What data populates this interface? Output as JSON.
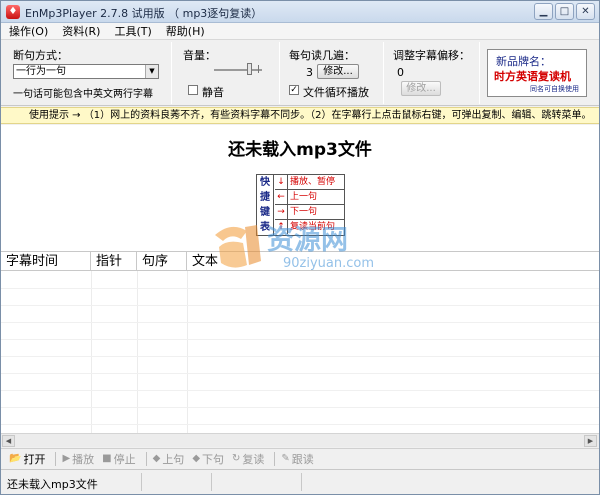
{
  "window": {
    "title": "EnMp3Player 2.7.8 试用版 （ mp3逐句复读）",
    "controls": {
      "minimize": "▁",
      "maximize": "□",
      "close": "✕"
    }
  },
  "menu": {
    "items": [
      "操作(O)",
      "资料(R)",
      "工具(T)",
      "帮助(H)"
    ]
  },
  "sentence": {
    "label": "断句方式：",
    "selected": "一行为一句",
    "note": "一句话可能包含中英文两行字幕"
  },
  "volume": {
    "label": "音量：",
    "level": 0.75,
    "mute_label": "静音",
    "mute_checked": false
  },
  "repeat": {
    "label": "每句读几遍：",
    "count": "3",
    "modify_label": "修改...",
    "loop_label": "文件循环播放",
    "loop_checked": true
  },
  "offset": {
    "label": "调整字幕偏移：",
    "value": "0",
    "modify_label": "修改..."
  },
  "ad": {
    "title": "新品牌名：",
    "brand": "时方英语复读机",
    "hint": "同名可自换使用"
  },
  "tips": {
    "text": "使用提示  →  （1）网上的资料良莠不齐，有些资料字幕不同步。（2）在字幕行上点击鼠标右键，可弹出复制、编辑、跳转菜单。"
  },
  "main": {
    "title": "还未载入mp3文件",
    "hotkeys_label": [
      "快",
      "捷",
      "键",
      "表"
    ],
    "hotkeys": [
      {
        "arrow": "↓",
        "action": "播放、暂停"
      },
      {
        "arrow": "←",
        "action": "上一句"
      },
      {
        "arrow": "→",
        "action": "下一句"
      },
      {
        "arrow": "↑",
        "action": "复读当前句"
      }
    ]
  },
  "table": {
    "columns": [
      "字幕时间",
      "指针",
      "句序",
      "文本"
    ]
  },
  "toolbar": {
    "open": "打开",
    "play": "播放",
    "stop": "停止",
    "prev": "上句",
    "next": "下句",
    "repeat": "复读",
    "follow": "跟读"
  },
  "status": {
    "text": "还未载入mp3文件"
  },
  "watermark": {
    "brand": "资源网",
    "url": "90ziyuan.com"
  },
  "colors": {
    "tip_bg": "#fff9c8",
    "red": "#d40000",
    "blue": "#1b2a88"
  }
}
